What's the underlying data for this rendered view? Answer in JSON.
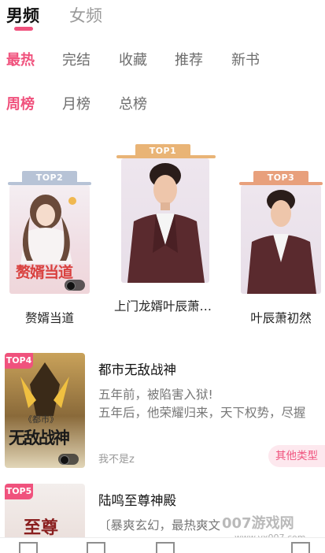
{
  "gender_tabs": [
    {
      "label": "男频",
      "active": true
    },
    {
      "label": "女频",
      "active": false
    }
  ],
  "categories": [
    "最热",
    "完结",
    "收藏",
    "推荐",
    "新书"
  ],
  "active_category": "最热",
  "rank_periods": [
    "周榜",
    "月榜",
    "总榜"
  ],
  "active_period": "周榜",
  "podium": [
    {
      "rank": "TOP1",
      "title": "上门龙婿叶辰萧…",
      "cover_text": ""
    },
    {
      "rank": "TOP2",
      "title": "赘婿当道",
      "cover_text": "赘婿当道"
    },
    {
      "rank": "TOP3",
      "title": "叶辰萧初然",
      "cover_text": ""
    }
  ],
  "list": [
    {
      "rank": "TOP4",
      "title": "都市无敌战神",
      "desc_line1": "五年前，被陷害入狱!",
      "desc_line2": "五年后，他荣耀归来，天下权势，尽握",
      "author": "我不是z",
      "type_tag": "其他类型",
      "cover_text": "无敌战神",
      "cover_subtext": "《都市》"
    },
    {
      "rank": "TOP5",
      "title": "陆鸣至尊神殿",
      "desc_line1": "〔暴爽玄幻，最热爽文",
      "cover_text": "至尊"
    }
  ],
  "watermark": "007游戏网",
  "watermark_url": "www.yx007.com",
  "colors": {
    "accent": "#f0527d",
    "top1": "#e9b476",
    "top2": "#b7c3d6",
    "top3": "#e8a07c"
  }
}
